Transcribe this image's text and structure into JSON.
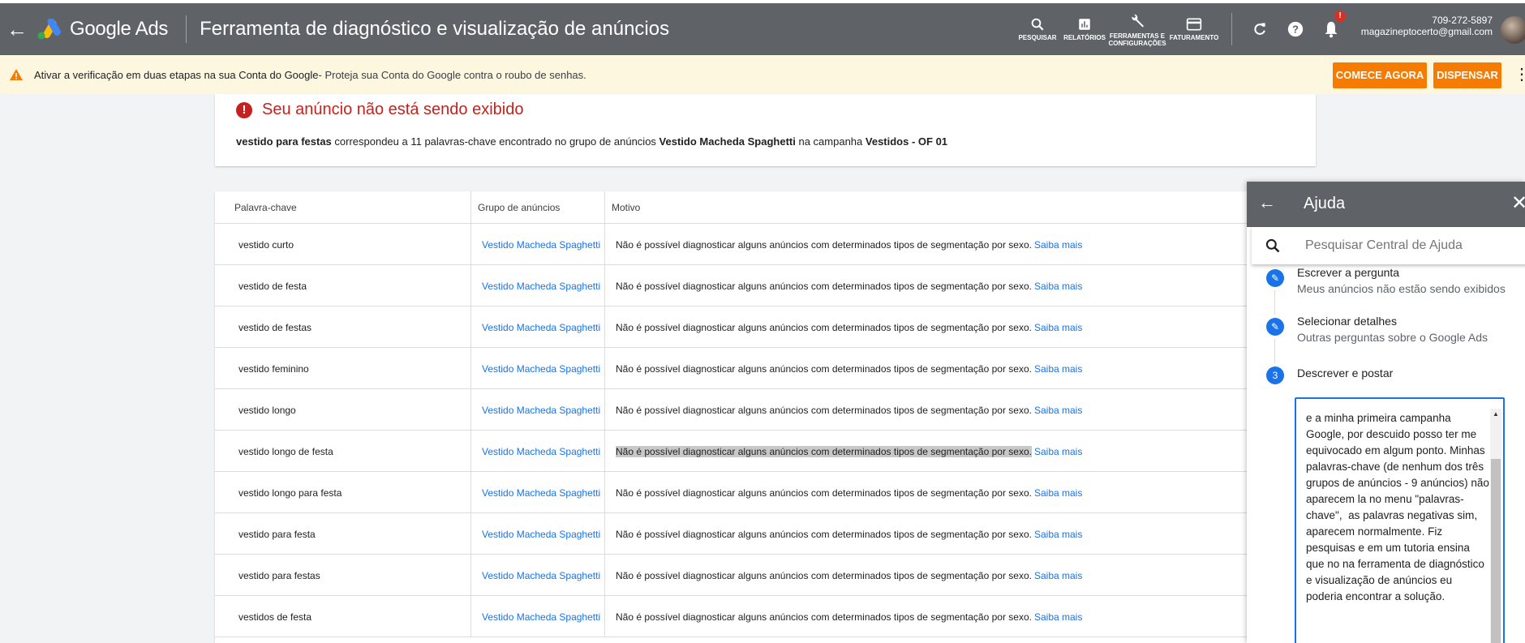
{
  "topbar": {
    "brand": "Google Ads",
    "title": "Ferramenta de diagnóstico e visualização de anúncios",
    "tools": [
      {
        "label": "PESQUISAR",
        "icon": "search-icon"
      },
      {
        "label": "RELATÓRIOS",
        "icon": "reports-icon"
      },
      {
        "label": "FERRAMENTAS E CONFIGURAÇÕES",
        "icon": "wrench-icon"
      },
      {
        "label": "FATURAMENTO",
        "icon": "credit-card-icon"
      }
    ],
    "notification_count": "!",
    "account_phone": "709-272-5897",
    "account_email": "magazineptocerto@gmail.com"
  },
  "notice": {
    "bold": "Ativar a verificação em duas etapas na sua Conta do Google",
    "rest": " - Proteja sua Conta do Google contra o roubo de senhas.",
    "start_label": "COMECE AGORA",
    "dismiss_label": "DISPENSAR"
  },
  "status": {
    "title": "Seu anúncio não está sendo exibido",
    "keyword": "vestido para festas",
    "text1": " correspondeu a 11 palavras-chave encontrado no grupo de anúncios ",
    "adgroup": "Vestido Macheda Spaghetti",
    "text2": " na campanha ",
    "campaign": "Vestidos - OF 01"
  },
  "table": {
    "headers": [
      "Palavra-chave",
      "Grupo de anúncios",
      "Motivo"
    ],
    "rows": [
      {
        "keyword": "vestido curto",
        "group": "Vestido Macheda Spaghetti",
        "reason": "Não é possível diagnosticar alguns anúncios com determinados tipos de segmentação por sexo.",
        "link": "Saiba mais"
      },
      {
        "keyword": "vestido de festa",
        "group": "Vestido Macheda Spaghetti",
        "reason": "Não é possível diagnosticar alguns anúncios com determinados tipos de segmentação por sexo.",
        "link": "Saiba mais"
      },
      {
        "keyword": "vestido de festas",
        "group": "Vestido Macheda Spaghetti",
        "reason": "Não é possível diagnosticar alguns anúncios com determinados tipos de segmentação por sexo.",
        "link": "Saiba mais"
      },
      {
        "keyword": "vestido feminino",
        "group": "Vestido Macheda Spaghetti",
        "reason": "Não é possível diagnosticar alguns anúncios com determinados tipos de segmentação por sexo.",
        "link": "Saiba mais"
      },
      {
        "keyword": "vestido longo",
        "group": "Vestido Macheda Spaghetti",
        "reason": "Não é possível diagnosticar alguns anúncios com determinados tipos de segmentação por sexo.",
        "link": "Saiba mais"
      },
      {
        "keyword": "vestido longo de festa",
        "group": "Vestido Macheda Spaghetti",
        "reason": "Não é possível diagnosticar alguns anúncios com determinados tipos de segmentação por sexo.",
        "link": "Saiba mais"
      },
      {
        "keyword": "vestido longo para festa",
        "group": "Vestido Macheda Spaghetti",
        "reason": "Não é possível diagnosticar alguns anúncios com determinados tipos de segmentação por sexo.",
        "link": "Saiba mais"
      },
      {
        "keyword": "vestido para festa",
        "group": "Vestido Macheda Spaghetti",
        "reason": "Não é possível diagnosticar alguns anúncios com determinados tipos de segmentação por sexo.",
        "link": "Saiba mais"
      },
      {
        "keyword": "vestido para festas",
        "group": "Vestido Macheda Spaghetti",
        "reason": "Não é possível diagnosticar alguns anúncios com determinados tipos de segmentação por sexo.",
        "link": "Saiba mais"
      },
      {
        "keyword": "vestidos de festa",
        "group": "Vestido Macheda Spaghetti",
        "reason": "Não é possível diagnosticar alguns anúncios com determinados tipos de segmentação por sexo.",
        "link": "Saiba mais"
      }
    ]
  },
  "help": {
    "title": "Ajuda",
    "search_placeholder": "Pesquisar Central de Ajuda",
    "steps": [
      {
        "title": "Escrever a pergunta",
        "subtitle": "Meus anúncios não estão sendo exibidos"
      },
      {
        "title": "Selecionar detalhes",
        "subtitle": "Outras perguntas sobre o Google Ads"
      },
      {
        "number": "3",
        "title": "Descrever e postar"
      }
    ],
    "message": "e a minha primeira campanha Google, por descuido posso ter me equivocado em algum ponto. Minhas palavras-chave (de nenhum dos três grupos de anúncios - 9 anúncios) não aparecem la no menu \"palavras-chave\",  as palavras negativas sim, aparecem normalmente. Fiz pesquisas e em um tutoria ensina que no na ferramenta de diagnóstico e visualização de anúncios eu poderia encontrar a solução."
  },
  "colors": {
    "topbar": "#5f6368",
    "accent": "#1a73e8",
    "warning": "#f57c00",
    "error": "#c5221f"
  }
}
